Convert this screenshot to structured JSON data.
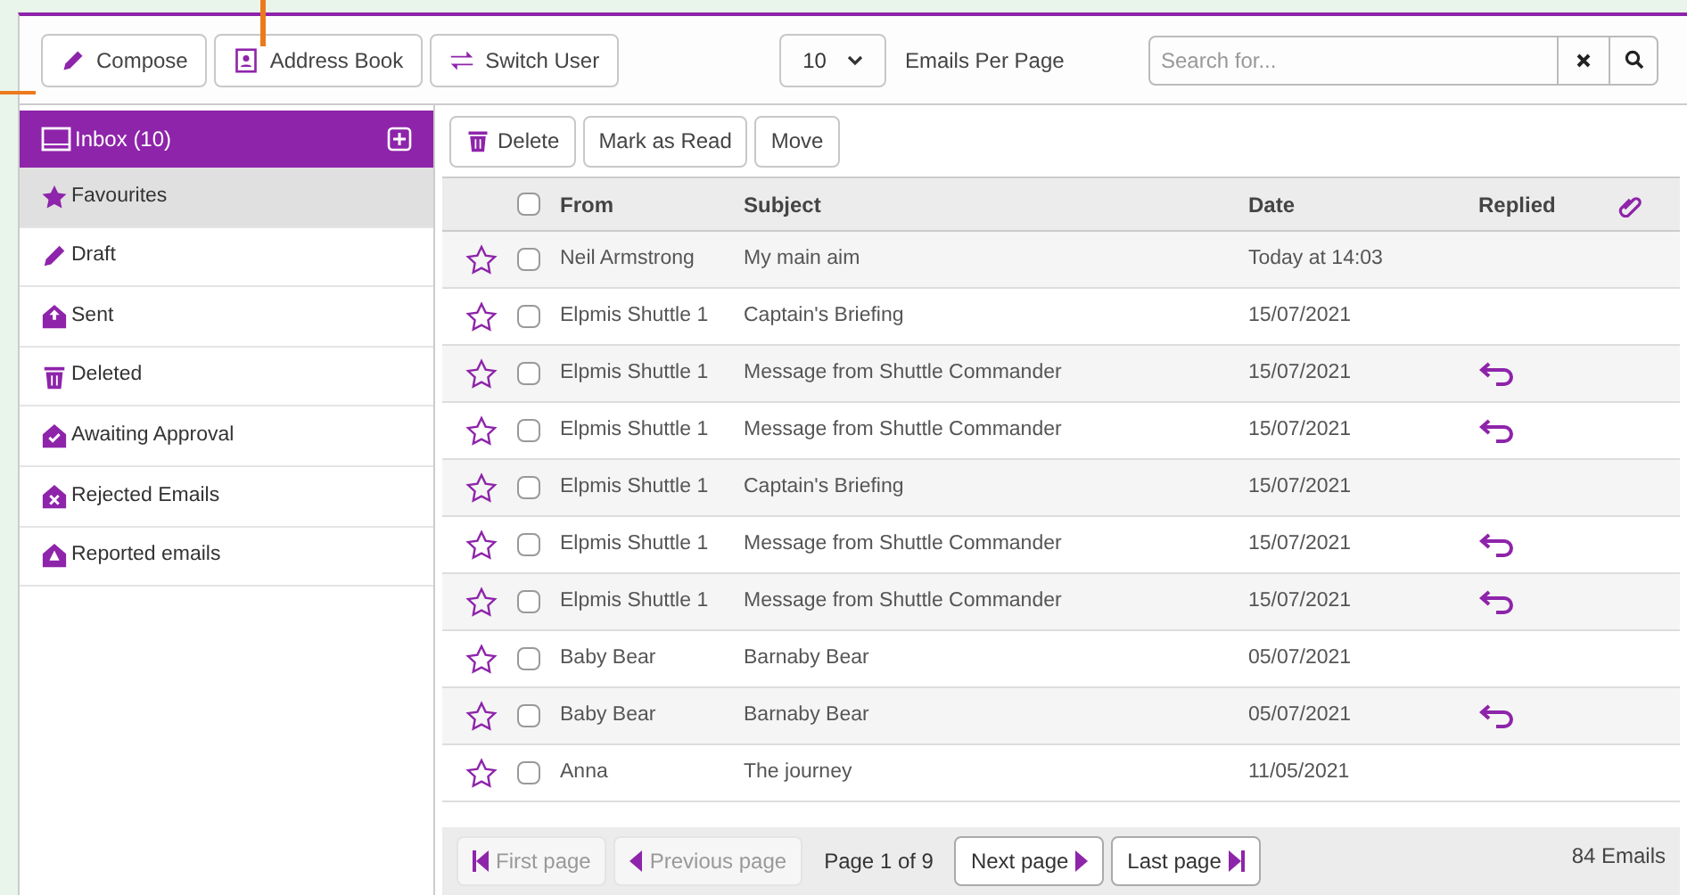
{
  "toolbar": {
    "buttons": [
      {
        "label": "Compose",
        "kind": "compose"
      },
      {
        "label": "Address Book",
        "kind": "address"
      },
      {
        "label": "Switch User",
        "kind": "switch"
      }
    ],
    "per_page": {
      "value": "10",
      "label": "Emails Per Page"
    },
    "search": {
      "placeholder": "Search for..."
    }
  },
  "sidebar": {
    "header": {
      "label": "Inbox (10)"
    },
    "items": [
      {
        "label": "Favourites",
        "kind": "star",
        "selected": true
      },
      {
        "label": "Draft",
        "kind": "pencil",
        "selected": false
      },
      {
        "label": "Sent",
        "kind": "sent",
        "selected": false
      },
      {
        "label": "Deleted",
        "kind": "trash",
        "selected": false
      },
      {
        "label": "Awaiting Approval",
        "kind": "approval",
        "selected": false
      },
      {
        "label": "Rejected Emails",
        "kind": "rejected",
        "selected": false
      },
      {
        "label": "Reported emails",
        "kind": "reported",
        "selected": false
      }
    ]
  },
  "actions": [
    {
      "label": "Delete",
      "kind": "delete"
    },
    {
      "label": "Mark as Read",
      "kind": "plain"
    },
    {
      "label": "Move",
      "kind": "plain"
    }
  ],
  "table": {
    "columns": [
      "From",
      "Subject",
      "Date",
      "Replied"
    ],
    "select_all": {
      "checked": false
    },
    "rows": [
      {
        "from": "Neil Armstrong",
        "subject": "My main aim",
        "date": "Today at 14:03",
        "replied": false,
        "starred": false,
        "checked": false
      },
      {
        "from": "Elpmis Shuttle 1",
        "subject": "Captain's Briefing",
        "date": "15/07/2021",
        "replied": false,
        "starred": false,
        "checked": false
      },
      {
        "from": "Elpmis Shuttle 1",
        "subject": "Message from Shuttle Commander",
        "date": "15/07/2021",
        "replied": true,
        "starred": false,
        "checked": false
      },
      {
        "from": "Elpmis Shuttle 1",
        "subject": "Message from Shuttle Commander",
        "date": "15/07/2021",
        "replied": true,
        "starred": false,
        "checked": false
      },
      {
        "from": "Elpmis Shuttle 1",
        "subject": "Captain's Briefing",
        "date": "15/07/2021",
        "replied": false,
        "starred": false,
        "checked": false
      },
      {
        "from": "Elpmis Shuttle 1",
        "subject": "Message from Shuttle Commander",
        "date": "15/07/2021",
        "replied": true,
        "starred": false,
        "checked": false
      },
      {
        "from": "Elpmis Shuttle 1",
        "subject": "Message from Shuttle Commander",
        "date": "15/07/2021",
        "replied": true,
        "starred": false,
        "checked": false
      },
      {
        "from": "Baby Bear",
        "subject": "Barnaby Bear",
        "date": "05/07/2021",
        "replied": false,
        "starred": false,
        "checked": false
      },
      {
        "from": "Baby Bear",
        "subject": "Barnaby Bear",
        "date": "05/07/2021",
        "replied": true,
        "starred": false,
        "checked": false
      },
      {
        "from": "Anna",
        "subject": "The journey",
        "date": "11/05/2021",
        "replied": false,
        "starred": false,
        "checked": false
      }
    ]
  },
  "pager": {
    "buttons": [
      {
        "label": "First page",
        "kind": "first",
        "disabled": true
      },
      {
        "label": "Previous page",
        "kind": "prev",
        "disabled": true
      },
      {
        "label": "Next page",
        "kind": "next",
        "disabled": false
      },
      {
        "label": "Last page",
        "kind": "last",
        "disabled": false
      }
    ],
    "status": "Page 1 of 9",
    "total": "84 Emails"
  }
}
